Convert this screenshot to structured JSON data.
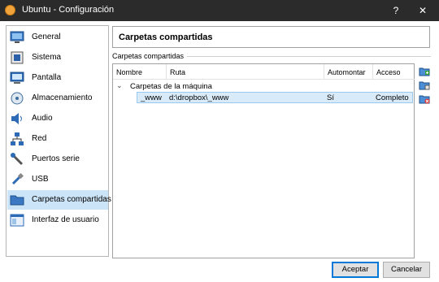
{
  "window": {
    "title": "Ubuntu - Configuración",
    "help_label": "?",
    "close_label": "✕"
  },
  "sidebar": {
    "items": [
      {
        "label": "General",
        "icon": "monitor-general-icon"
      },
      {
        "label": "Sistema",
        "icon": "chip-icon"
      },
      {
        "label": "Pantalla",
        "icon": "display-icon"
      },
      {
        "label": "Almacenamiento",
        "icon": "disk-icon"
      },
      {
        "label": "Audio",
        "icon": "speaker-icon"
      },
      {
        "label": "Red",
        "icon": "network-icon"
      },
      {
        "label": "Puertos serie",
        "icon": "serial-port-icon"
      },
      {
        "label": "USB",
        "icon": "usb-icon"
      },
      {
        "label": "Carpetas compartidas",
        "icon": "folder-icon"
      },
      {
        "label": "Interfaz de usuario",
        "icon": "ui-window-icon"
      }
    ],
    "selected_index": 8
  },
  "page": {
    "title": "Carpetas compartidas",
    "group_title": "Carpetas compartidas"
  },
  "table": {
    "columns": [
      "Nombre",
      "Ruta",
      "Automontar",
      "Acceso"
    ],
    "group_label": "Carpetas de la máquina",
    "rows": [
      {
        "name": "_www",
        "path": "d:\\dropbox\\_www",
        "automount": "Sí",
        "access": "Completo"
      }
    ]
  },
  "toolbar": {
    "tools": [
      "add-folder-icon",
      "edit-folder-icon",
      "remove-folder-icon"
    ]
  },
  "buttons": {
    "ok": "Aceptar",
    "cancel": "Cancelar"
  },
  "colors": {
    "titlebar": "#2b2b2b",
    "selection": "#cce4f7",
    "row_selection": "#d9ebf9",
    "accent": "#0078d7"
  }
}
